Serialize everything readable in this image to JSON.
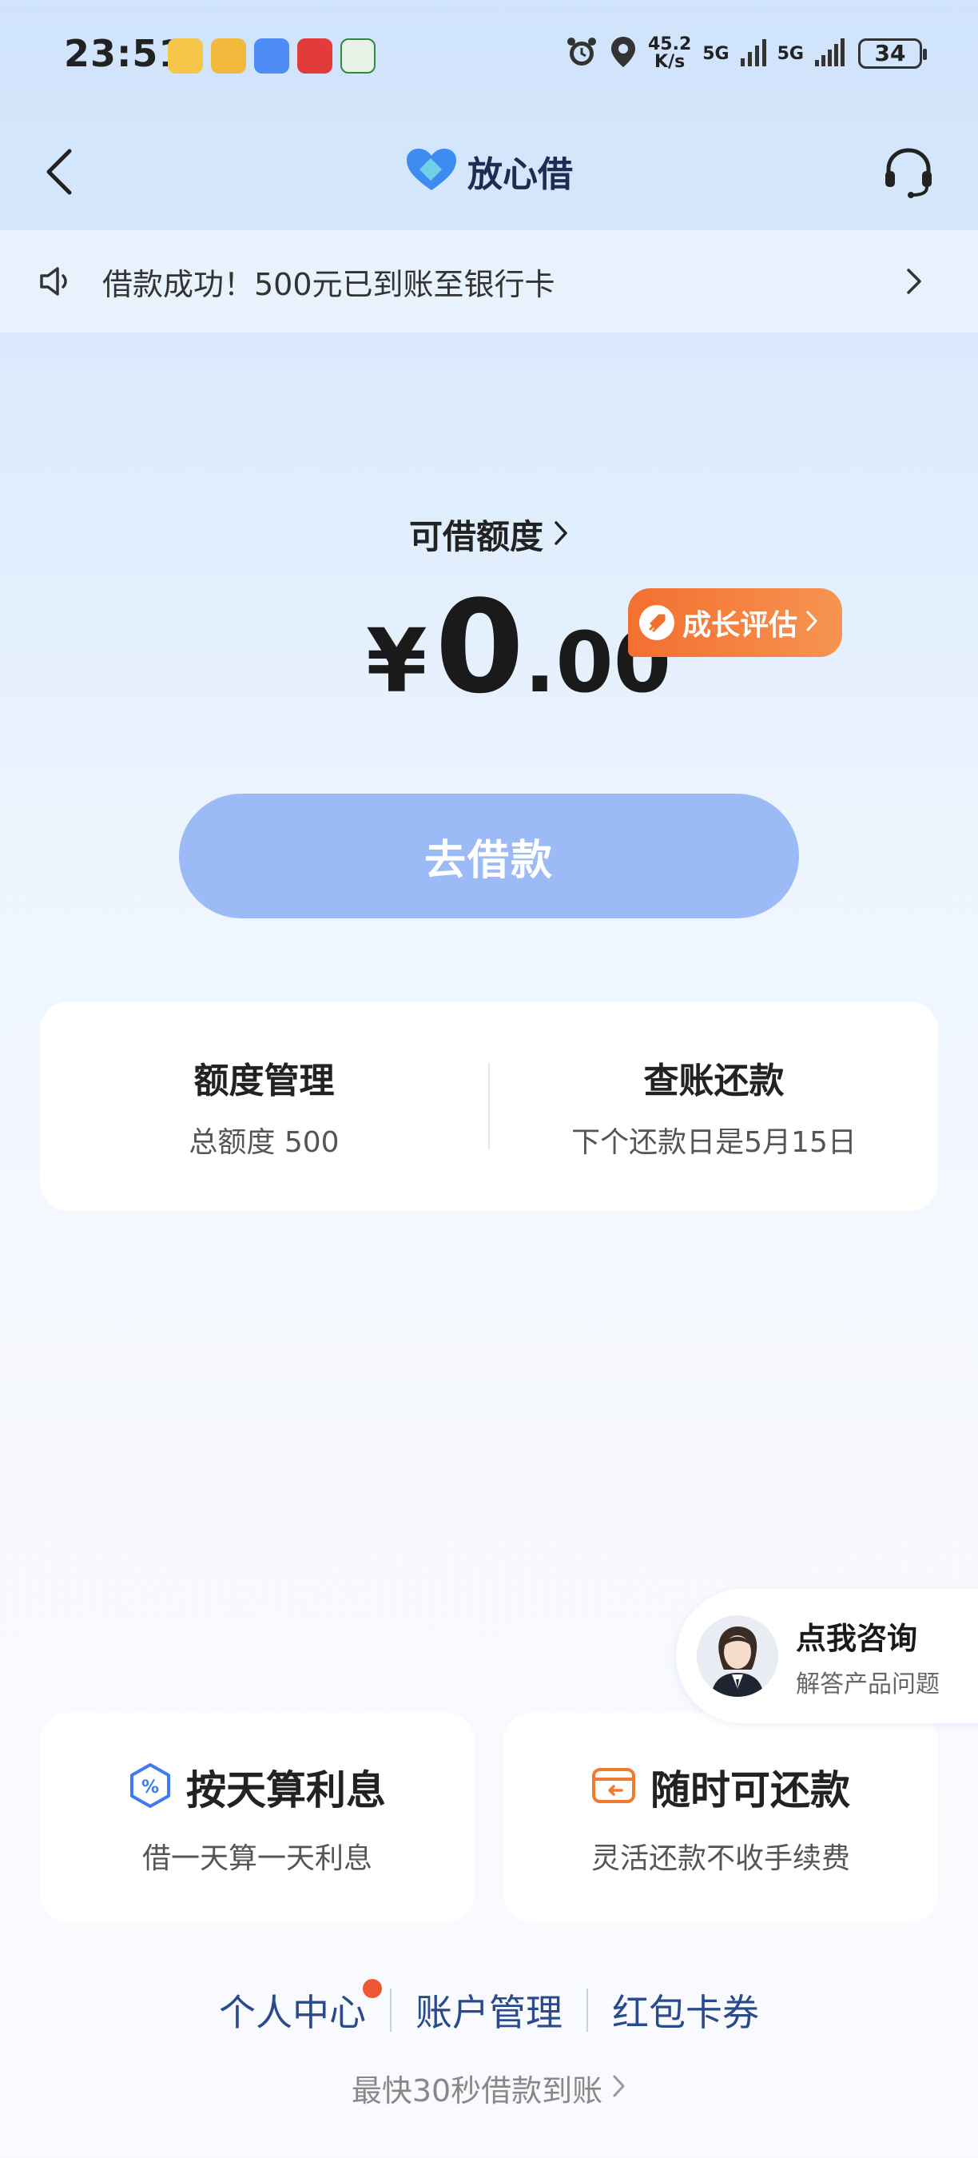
{
  "status_bar": {
    "time": "23:51",
    "net_speed_value": "45.2",
    "net_speed_unit": "K/s",
    "signal_1": "5G",
    "signal_2": "5G",
    "battery": "34"
  },
  "nav": {
    "title": "放心借"
  },
  "notice": {
    "text": "借款成功！500元已到账至银行卡"
  },
  "quota": {
    "label": "可借额度",
    "currency": "¥",
    "amount_int": "0",
    "amount_dec": ".00",
    "growth_badge": "成长评估"
  },
  "borrow_button": "去借款",
  "management": {
    "limit_title": "额度管理",
    "limit_sub": "总额度 500",
    "repay_title": "查账还款",
    "repay_sub": "下个还款日是5月15日"
  },
  "consult": {
    "title": "点我咨询",
    "subtitle": "解答产品问题"
  },
  "features": [
    {
      "title": "按天算利息",
      "subtitle": "借一天算一天利息",
      "icon": "percent-hexagon-icon"
    },
    {
      "title": "随时可还款",
      "subtitle": "灵活还款不收手续费",
      "icon": "wallet-return-icon"
    }
  ],
  "bottom_links": {
    "personal": "个人中心",
    "account": "账户管理",
    "coupons": "红包卡券"
  },
  "bottom_tip": "最快30秒借款到账",
  "colors": {
    "brand_blue": "#2a4a8c",
    "button_blue": "#9cbaf5",
    "badge_orange": "#f36f30",
    "red_dot": "#ef5633"
  }
}
